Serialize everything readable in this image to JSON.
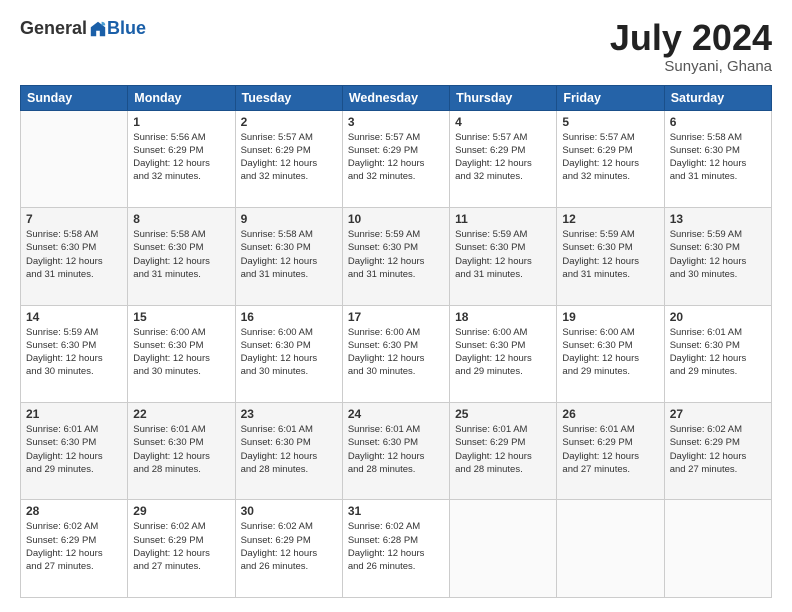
{
  "header": {
    "logo_general": "General",
    "logo_blue": "Blue",
    "title": "July 2024",
    "location": "Sunyani, Ghana"
  },
  "days_of_week": [
    "Sunday",
    "Monday",
    "Tuesday",
    "Wednesday",
    "Thursday",
    "Friday",
    "Saturday"
  ],
  "weeks": [
    [
      {
        "day": "",
        "info": ""
      },
      {
        "day": "1",
        "info": "Sunrise: 5:56 AM\nSunset: 6:29 PM\nDaylight: 12 hours\nand 32 minutes."
      },
      {
        "day": "2",
        "info": "Sunrise: 5:57 AM\nSunset: 6:29 PM\nDaylight: 12 hours\nand 32 minutes."
      },
      {
        "day": "3",
        "info": "Sunrise: 5:57 AM\nSunset: 6:29 PM\nDaylight: 12 hours\nand 32 minutes."
      },
      {
        "day": "4",
        "info": "Sunrise: 5:57 AM\nSunset: 6:29 PM\nDaylight: 12 hours\nand 32 minutes."
      },
      {
        "day": "5",
        "info": "Sunrise: 5:57 AM\nSunset: 6:29 PM\nDaylight: 12 hours\nand 32 minutes."
      },
      {
        "day": "6",
        "info": "Sunrise: 5:58 AM\nSunset: 6:30 PM\nDaylight: 12 hours\nand 31 minutes."
      }
    ],
    [
      {
        "day": "7",
        "info": "Sunrise: 5:58 AM\nSunset: 6:30 PM\nDaylight: 12 hours\nand 31 minutes."
      },
      {
        "day": "8",
        "info": "Sunrise: 5:58 AM\nSunset: 6:30 PM\nDaylight: 12 hours\nand 31 minutes."
      },
      {
        "day": "9",
        "info": "Sunrise: 5:58 AM\nSunset: 6:30 PM\nDaylight: 12 hours\nand 31 minutes."
      },
      {
        "day": "10",
        "info": "Sunrise: 5:59 AM\nSunset: 6:30 PM\nDaylight: 12 hours\nand 31 minutes."
      },
      {
        "day": "11",
        "info": "Sunrise: 5:59 AM\nSunset: 6:30 PM\nDaylight: 12 hours\nand 31 minutes."
      },
      {
        "day": "12",
        "info": "Sunrise: 5:59 AM\nSunset: 6:30 PM\nDaylight: 12 hours\nand 31 minutes."
      },
      {
        "day": "13",
        "info": "Sunrise: 5:59 AM\nSunset: 6:30 PM\nDaylight: 12 hours\nand 30 minutes."
      }
    ],
    [
      {
        "day": "14",
        "info": "Sunrise: 5:59 AM\nSunset: 6:30 PM\nDaylight: 12 hours\nand 30 minutes."
      },
      {
        "day": "15",
        "info": "Sunrise: 6:00 AM\nSunset: 6:30 PM\nDaylight: 12 hours\nand 30 minutes."
      },
      {
        "day": "16",
        "info": "Sunrise: 6:00 AM\nSunset: 6:30 PM\nDaylight: 12 hours\nand 30 minutes."
      },
      {
        "day": "17",
        "info": "Sunrise: 6:00 AM\nSunset: 6:30 PM\nDaylight: 12 hours\nand 30 minutes."
      },
      {
        "day": "18",
        "info": "Sunrise: 6:00 AM\nSunset: 6:30 PM\nDaylight: 12 hours\nand 29 minutes."
      },
      {
        "day": "19",
        "info": "Sunrise: 6:00 AM\nSunset: 6:30 PM\nDaylight: 12 hours\nand 29 minutes."
      },
      {
        "day": "20",
        "info": "Sunrise: 6:01 AM\nSunset: 6:30 PM\nDaylight: 12 hours\nand 29 minutes."
      }
    ],
    [
      {
        "day": "21",
        "info": "Sunrise: 6:01 AM\nSunset: 6:30 PM\nDaylight: 12 hours\nand 29 minutes."
      },
      {
        "day": "22",
        "info": "Sunrise: 6:01 AM\nSunset: 6:30 PM\nDaylight: 12 hours\nand 28 minutes."
      },
      {
        "day": "23",
        "info": "Sunrise: 6:01 AM\nSunset: 6:30 PM\nDaylight: 12 hours\nand 28 minutes."
      },
      {
        "day": "24",
        "info": "Sunrise: 6:01 AM\nSunset: 6:30 PM\nDaylight: 12 hours\nand 28 minutes."
      },
      {
        "day": "25",
        "info": "Sunrise: 6:01 AM\nSunset: 6:29 PM\nDaylight: 12 hours\nand 28 minutes."
      },
      {
        "day": "26",
        "info": "Sunrise: 6:01 AM\nSunset: 6:29 PM\nDaylight: 12 hours\nand 27 minutes."
      },
      {
        "day": "27",
        "info": "Sunrise: 6:02 AM\nSunset: 6:29 PM\nDaylight: 12 hours\nand 27 minutes."
      }
    ],
    [
      {
        "day": "28",
        "info": "Sunrise: 6:02 AM\nSunset: 6:29 PM\nDaylight: 12 hours\nand 27 minutes."
      },
      {
        "day": "29",
        "info": "Sunrise: 6:02 AM\nSunset: 6:29 PM\nDaylight: 12 hours\nand 27 minutes."
      },
      {
        "day": "30",
        "info": "Sunrise: 6:02 AM\nSunset: 6:29 PM\nDaylight: 12 hours\nand 26 minutes."
      },
      {
        "day": "31",
        "info": "Sunrise: 6:02 AM\nSunset: 6:28 PM\nDaylight: 12 hours\nand 26 minutes."
      },
      {
        "day": "",
        "info": ""
      },
      {
        "day": "",
        "info": ""
      },
      {
        "day": "",
        "info": ""
      }
    ]
  ]
}
